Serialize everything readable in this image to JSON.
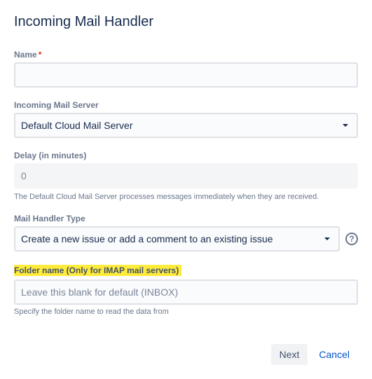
{
  "header": {
    "title": "Incoming Mail Handler"
  },
  "fields": {
    "name": {
      "label": "Name",
      "value": ""
    },
    "mailServer": {
      "label": "Incoming Mail Server",
      "selected": "Default Cloud Mail Server"
    },
    "delay": {
      "label": "Delay (in minutes)",
      "placeholder": "0",
      "description": "The Default Cloud Mail Server processes messages immediately when they are received."
    },
    "handlerType": {
      "label": "Mail Handler Type",
      "selected": "Create a new issue or add a comment to an existing issue"
    },
    "folderName": {
      "label": "Folder name (Only for IMAP mail servers)",
      "placeholder": "Leave this blank for default (INBOX)",
      "helper": "Specify the folder name to read the data from"
    }
  },
  "buttons": {
    "next": "Next",
    "cancel": "Cancel"
  }
}
